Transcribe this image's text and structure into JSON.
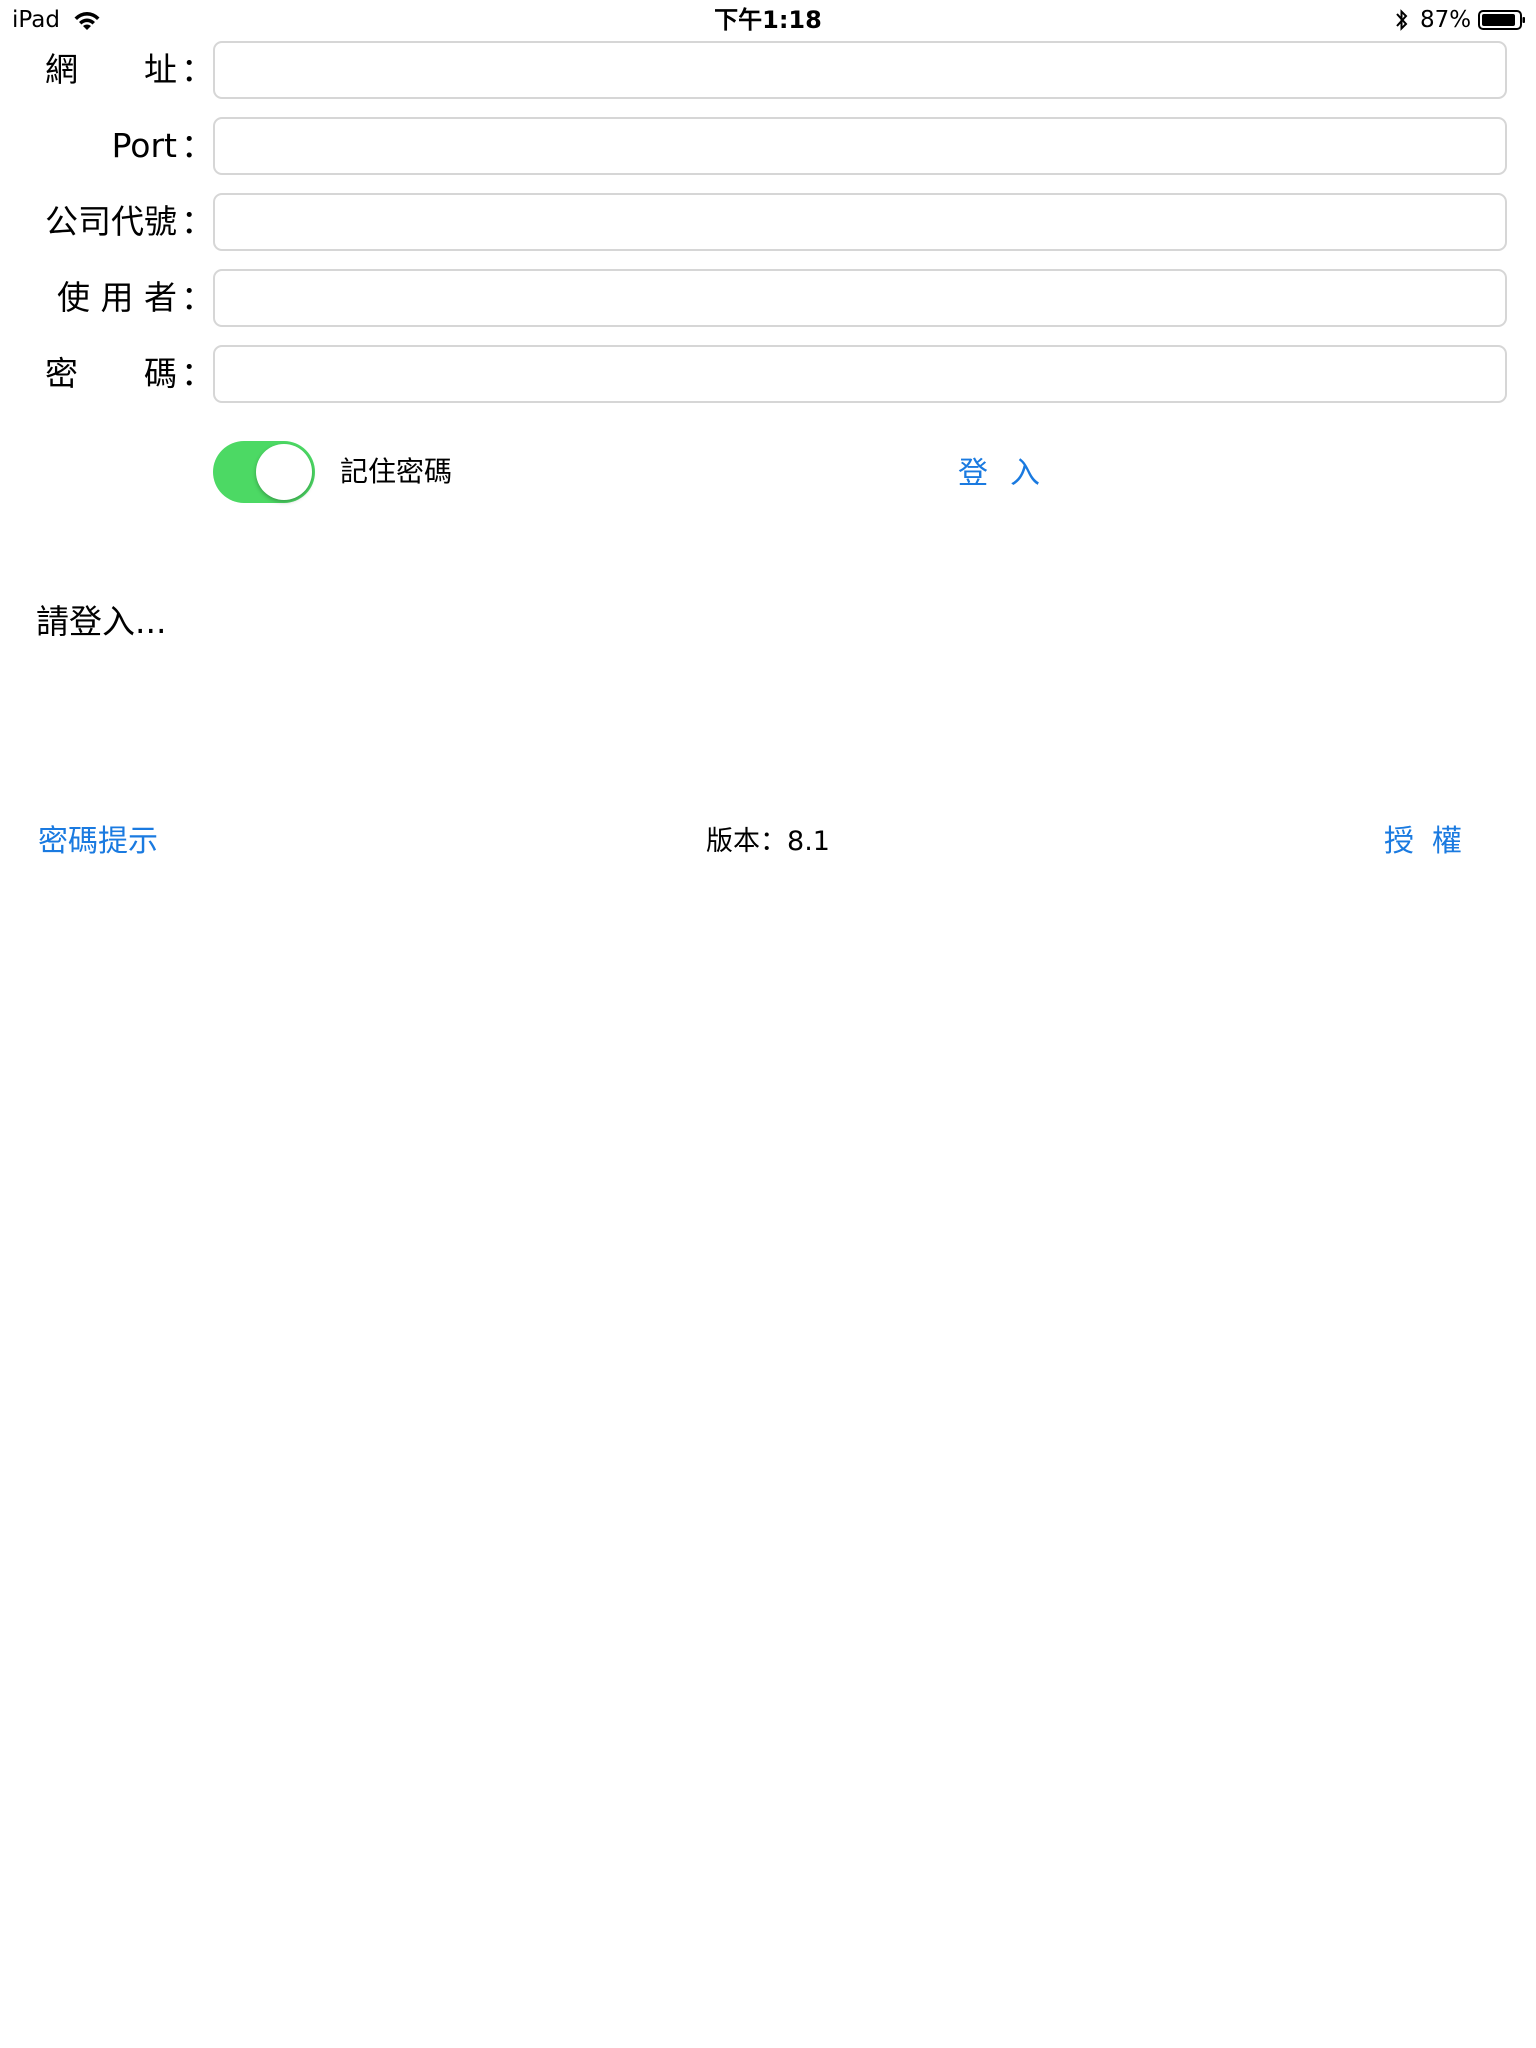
{
  "status_bar": {
    "device": "iPad",
    "time": "下午1:18",
    "battery_text": "87%",
    "icons": [
      "wifi-icon",
      "bluetooth-icon",
      "battery-icon"
    ]
  },
  "form": {
    "fields": [
      {
        "label": "網　　址",
        "colon": "：",
        "value": "",
        "placeholder": ""
      },
      {
        "label": "Port",
        "colon": "：",
        "value": "",
        "placeholder": ""
      },
      {
        "label": "公司代號",
        "colon": "：",
        "value": "",
        "placeholder": ""
      },
      {
        "label": "使 用 者",
        "colon": "：",
        "value": "",
        "placeholder": ""
      },
      {
        "label": "密　　碼",
        "colon": "：",
        "value": "",
        "placeholder": ""
      }
    ],
    "remember_label": "記住密碼",
    "remember_on": true,
    "login_label": "登入"
  },
  "status_message": "請登入...",
  "footer": {
    "hint_label": "密碼提示",
    "version_text": "版本：8.1",
    "license_label": "授權"
  },
  "colors": {
    "accent": "#1a7ae0",
    "toggle_on": "#4cd964",
    "field_border": "#d6d6d6"
  }
}
